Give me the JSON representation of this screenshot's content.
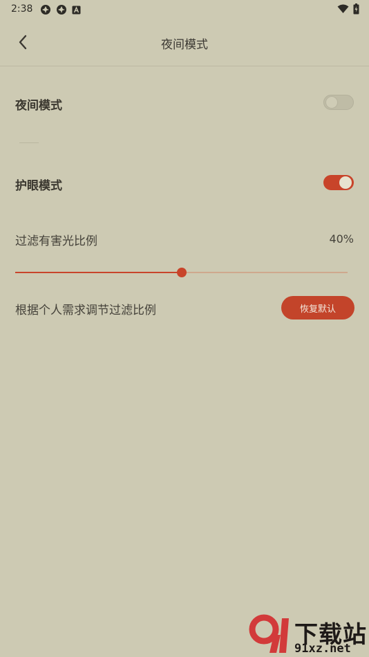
{
  "status_bar": {
    "time": "2:38",
    "left_icons": [
      "app-icon",
      "app-icon",
      "a-icon"
    ],
    "right_icons": [
      "wifi-icon",
      "battery-icon"
    ]
  },
  "header": {
    "title": "夜间模式"
  },
  "night_mode": {
    "label": "夜间模式",
    "enabled": false
  },
  "eye_care": {
    "label": "护眼模式",
    "enabled": true
  },
  "filter": {
    "label": "过滤有害光比例",
    "percent_text": "40%",
    "slider_fraction": 0.5,
    "description": "根据个人需求调节过滤比例",
    "reset_label": "恢复默认"
  },
  "watermark": {
    "title": "下载站",
    "subtitle": "91xz.net"
  },
  "colors": {
    "background": "#cdcab3",
    "accent": "#c8442a",
    "switch_off": "#bfbca6",
    "text": "#3f3b33"
  }
}
